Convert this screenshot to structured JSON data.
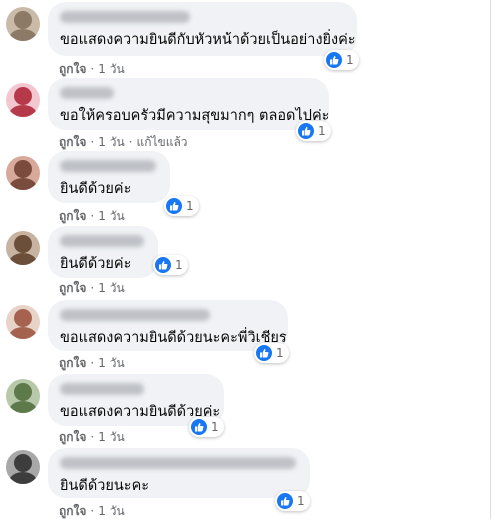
{
  "comments": [
    {
      "text": "ขอแสดงความยินดีกับหัวหน้าด้วยเป็นอย่างยิ่งค่ะ",
      "like_label": "ถูกใจ",
      "time": "1 วัน",
      "edited": "",
      "reactions": "1",
      "reaction_icon": "like-icon",
      "avatar_colors": [
        "#c9bba7",
        "#8c7a66"
      ]
    },
    {
      "text": "ขอให้ครอบครัวมีความสุขมากๆ ตลอดไปค่ะ",
      "like_label": "ถูกใจ",
      "time": "1 วัน",
      "edited": "แก้ไขแล้ว",
      "reactions": "1",
      "reaction_icon": "like-icon",
      "avatar_colors": [
        "#f3c7cf",
        "#b6394a"
      ]
    },
    {
      "text": "ยินดีด้วยค่ะ",
      "like_label": "ถูกใจ",
      "time": "1 วัน",
      "edited": "",
      "reactions": "1",
      "reaction_icon": "like-icon",
      "avatar_colors": [
        "#d8a99a",
        "#7a4c3e"
      ]
    },
    {
      "text": "ยินดีด้วยค่ะ",
      "like_label": "ถูกใจ",
      "time": "1 วัน",
      "edited": "",
      "reactions": "1",
      "reaction_icon": "like-icon",
      "avatar_colors": [
        "#c7b3a0",
        "#6b4f3a"
      ]
    },
    {
      "text": "ขอแสดงความยินดีด้วยนะคะพี่วิเชียร",
      "like_label": "ถูกใจ",
      "time": "1 วัน",
      "edited": "",
      "reactions": "1",
      "reaction_icon": "like-icon",
      "avatar_colors": [
        "#e7d3c7",
        "#a5634f"
      ]
    },
    {
      "text": "ขอแสดงความยินดีด้วยค่ะ",
      "like_label": "ถูกใจ",
      "time": "1 วัน",
      "edited": "",
      "reactions": "1",
      "reaction_icon": "like-icon",
      "avatar_colors": [
        "#b7c9a8",
        "#5e7a4a"
      ]
    },
    {
      "text": "ยินดีด้วยนะคะ",
      "like_label": "ถูกใจ",
      "time": "1 วัน",
      "edited": "",
      "reactions": "1",
      "reaction_icon": "like-icon",
      "avatar_colors": [
        "#a8a8a8",
        "#3d3d3d"
      ]
    }
  ],
  "colors": {
    "like_blue": "#1877f2",
    "bubble_bg": "#f0f2f5",
    "meta_gray": "#65676b"
  }
}
